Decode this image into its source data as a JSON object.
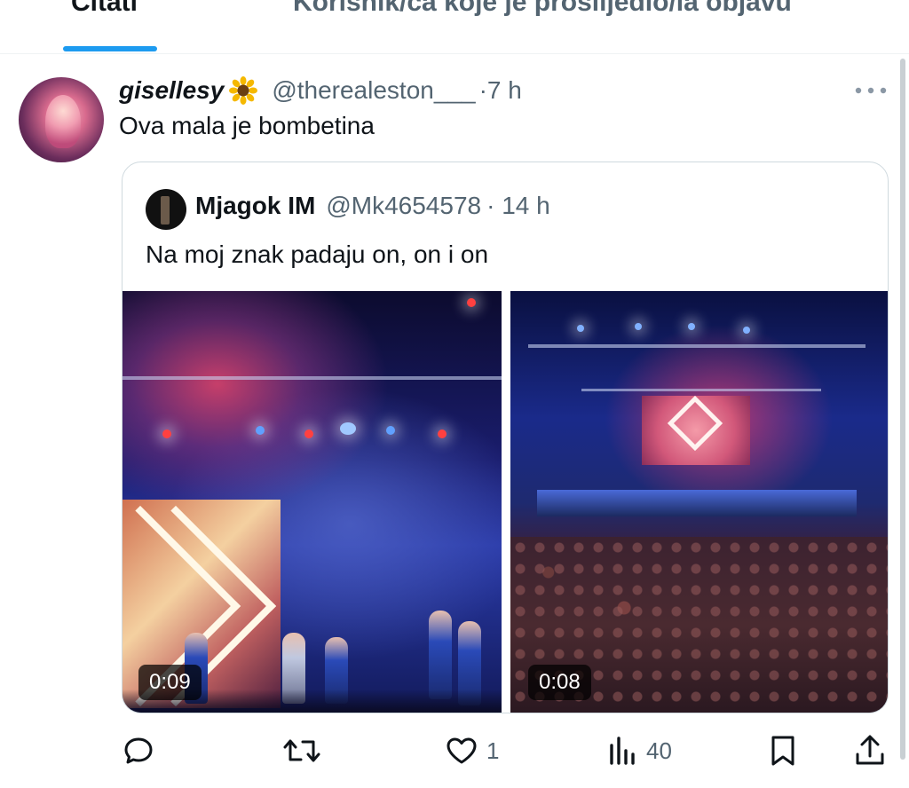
{
  "tabs": {
    "active": "Citati",
    "inactive": "Korisnik/ca koje je proslijedio/la objavu"
  },
  "tweet": {
    "display_name": "gisellesy",
    "emoji_icon": "sunflower-icon",
    "handle": "@therealeston___",
    "time": "·7 h",
    "text": "Ova mala je bombetina"
  },
  "quote": {
    "display_name": "Mjagok IM",
    "handle": "@Mk4654578",
    "time": "· 14 h",
    "text": "Na moj znak padaju on, on i on",
    "media": [
      {
        "type": "video",
        "duration": "0:09"
      },
      {
        "type": "video",
        "duration": "0:08"
      }
    ]
  },
  "actions": {
    "reply_icon": "reply-icon",
    "retweet_icon": "retweet-icon",
    "like_icon": "heart-icon",
    "like_count": "1",
    "views_icon": "views-icon",
    "views_count": "40",
    "bookmark_icon": "bookmark-icon",
    "share_icon": "share-icon"
  },
  "colors": {
    "accent": "#1d9bf0",
    "text_primary": "#0f1419",
    "text_secondary": "#536471",
    "border": "#cfd9de"
  }
}
